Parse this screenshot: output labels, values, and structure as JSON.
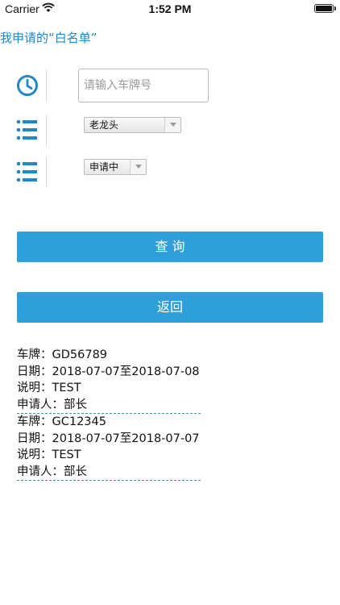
{
  "status_bar": {
    "carrier": "Carrier",
    "time": "1:52 PM",
    "wifi_icon": "wifi-icon",
    "battery_icon": "battery-icon"
  },
  "page_title": "我申请的“白名单”",
  "filters": {
    "time_icon": "clock-icon",
    "plate_placeholder": "请输入车牌号",
    "location_icon": "list-icon",
    "location_value": "老龙头",
    "status_icon": "list-icon",
    "status_value": "申请中"
  },
  "buttons": {
    "query": "查 询",
    "back": "返回"
  },
  "records": [
    {
      "plate": "车牌：GD56789",
      "date": "日期：2018-07-07至2018-07-08",
      "note": "说明：TEST",
      "applicant": "申请人：部长"
    },
    {
      "plate": "车牌：GC12345",
      "date": "日期：2018-07-07至2018-07-07",
      "note": "说明：TEST",
      "applicant": "申请人：部长"
    }
  ],
  "colors": {
    "accent": "#2e9fd8",
    "title": "#1e88c8",
    "record_divider": "#3a9a94"
  }
}
